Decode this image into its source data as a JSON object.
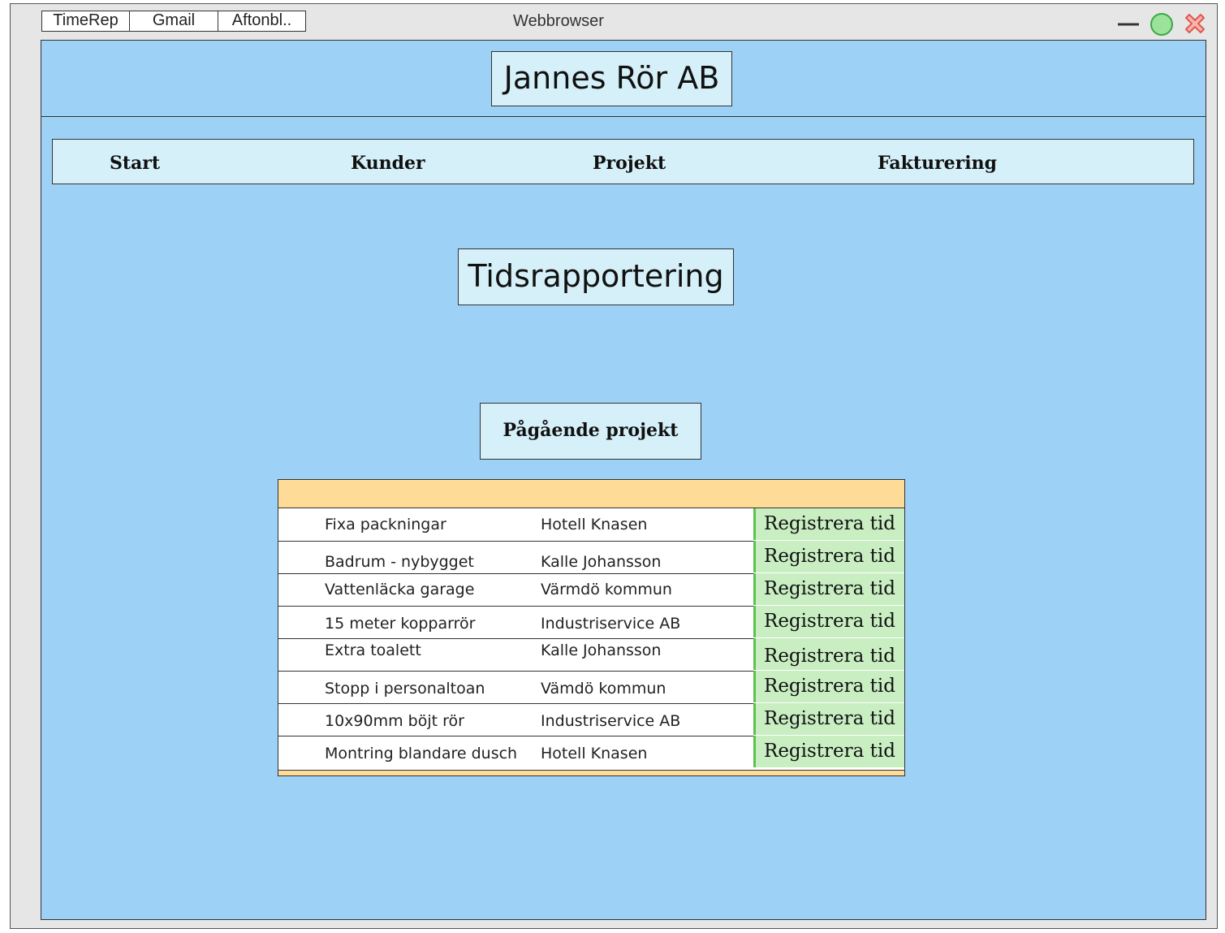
{
  "browser": {
    "title": "Webbrowser",
    "tabs": [
      {
        "label": "TimeRep"
      },
      {
        "label": "Gmail"
      },
      {
        "label": "Aftonbl.."
      }
    ]
  },
  "header": {
    "site_title": "Jannes Rör AB"
  },
  "nav": {
    "items": [
      {
        "label": "Start"
      },
      {
        "label": "Kunder"
      },
      {
        "label": "Projekt"
      },
      {
        "label": "Fakturering"
      }
    ]
  },
  "main": {
    "page_title": "Tidsrapportering",
    "section_title": "Pågående projekt",
    "projects": [
      {
        "project": "Fixa packningar",
        "customer": "Hotell Knasen",
        "action": "Registrera tid"
      },
      {
        "project": "Badrum - nybygget",
        "customer": "Kalle Johansson",
        "action": "Registrera tid"
      },
      {
        "project": "Vattenläcka garage",
        "customer": "Värmdö kommun",
        "action": "Registrera tid"
      },
      {
        "project": "15 meter kopparrör",
        "customer": "Industriservice AB",
        "action": "Registrera tid"
      },
      {
        "project": "Extra toalett",
        "customer": "Kalle Johansson",
        "action": "Registrera tid"
      },
      {
        "project": "Stopp i personaltoan",
        "customer": "Vämdö kommun",
        "action": "Registrera tid"
      },
      {
        "project": "10x90mm böjt rör",
        "customer": "Industriservice AB",
        "action": "Registrera tid"
      },
      {
        "project": "Montring blandare dusch",
        "customer": "Hotell Knasen",
        "action": "Registrera tid"
      }
    ]
  },
  "colors": {
    "content_bg": "#9ed1f6",
    "box_bg": "#d5f0f8",
    "table_header": "#fedc97",
    "action_bg": "#c8eec2",
    "close": "#e2574c",
    "maximize": "#57c75d"
  },
  "icons": {
    "minimize": "minimize-icon",
    "maximize": "maximize-icon",
    "close": "close-icon"
  }
}
